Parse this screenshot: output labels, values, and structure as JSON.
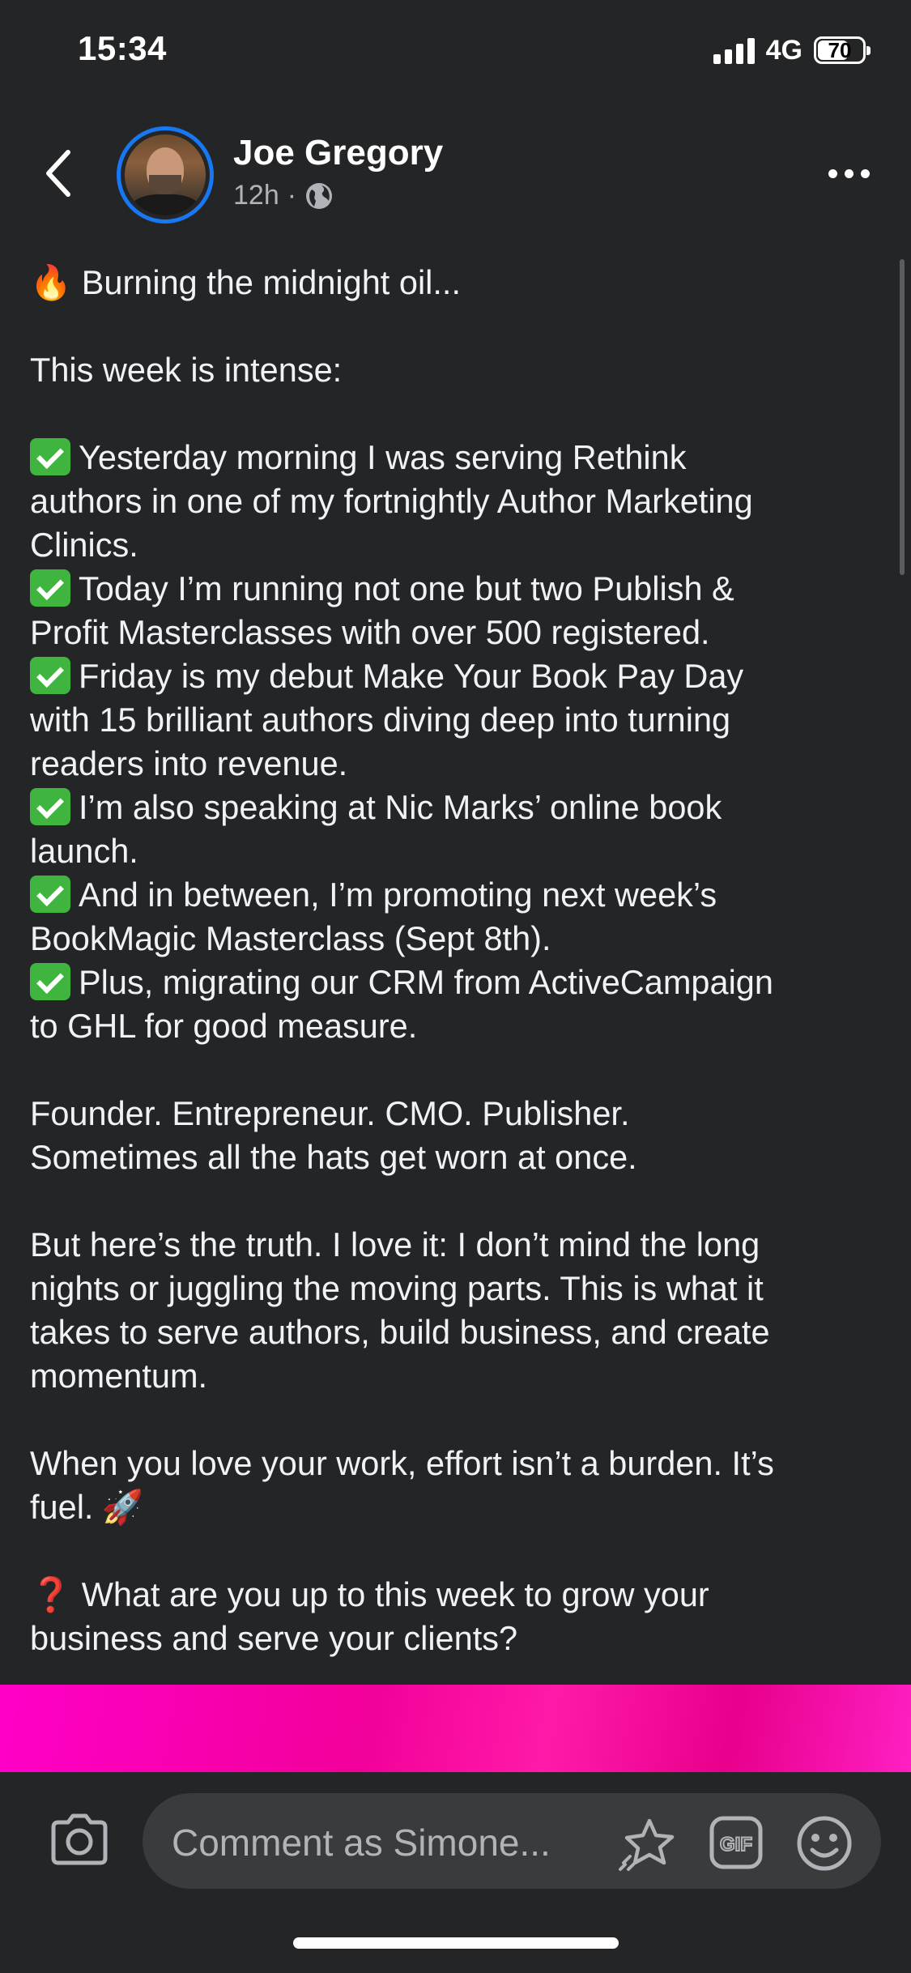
{
  "status_bar": {
    "time": "15:34",
    "network": "4G",
    "battery_level": "70"
  },
  "post": {
    "author": "Joe Gregory",
    "time_ago": "12h",
    "separator": "·",
    "audience_icon": "globe-icon",
    "lines": [
      {
        "emoji": "🔥",
        "text": "Burning the midnight oil..."
      },
      {
        "text": ""
      },
      {
        "text": "This week is intense:"
      },
      {
        "text": ""
      },
      {
        "check": true,
        "text": "Yesterday morning I was serving Rethink"
      },
      {
        "text": "authors in one of my fortnightly Author Marketing"
      },
      {
        "text": "Clinics."
      },
      {
        "check": true,
        "text": "Today I’m running not one but two Publish &"
      },
      {
        "text": "Profit Masterclasses with over 500 registered."
      },
      {
        "check": true,
        "text": "Friday is my debut Make Your Book Pay Day"
      },
      {
        "text": "with 15 brilliant authors diving deep into turning"
      },
      {
        "text": "readers into revenue."
      },
      {
        "check": true,
        "text": "I’m also speaking at Nic Marks’ online book"
      },
      {
        "text": "launch."
      },
      {
        "check": true,
        "text": "And in between, I’m promoting next week’s"
      },
      {
        "text": "BookMagic Masterclass (Sept 8th)."
      },
      {
        "check": true,
        "text": "Plus, migrating our CRM from ActiveCampaign"
      },
      {
        "text": "to GHL for good measure."
      },
      {
        "text": ""
      },
      {
        "text": "Founder. Entrepreneur. CMO. Publisher."
      },
      {
        "text": "Sometimes all the hats get worn at once."
      },
      {
        "text": ""
      },
      {
        "text": "But here’s the truth. I love it: I don’t mind the long"
      },
      {
        "text": "nights or juggling the moving parts. This is what it"
      },
      {
        "text": "takes to serve authors, build business, and create"
      },
      {
        "text": "momentum."
      },
      {
        "text": ""
      },
      {
        "text": "When you love your work, effort isn’t a burden. It’s"
      },
      {
        "text": "fuel.",
        "emoji_after": "🚀"
      },
      {
        "text": ""
      },
      {
        "emoji": "❓",
        "text": "What are you up to this week to grow your"
      },
      {
        "text": "business and serve your clients?"
      }
    ]
  },
  "comment_bar": {
    "placeholder": "Comment as Simone..."
  },
  "colors": {
    "background": "#242526",
    "accent_ring": "#1877f2",
    "check_green": "#3fb53f",
    "media_pink": "#ff00c8"
  }
}
